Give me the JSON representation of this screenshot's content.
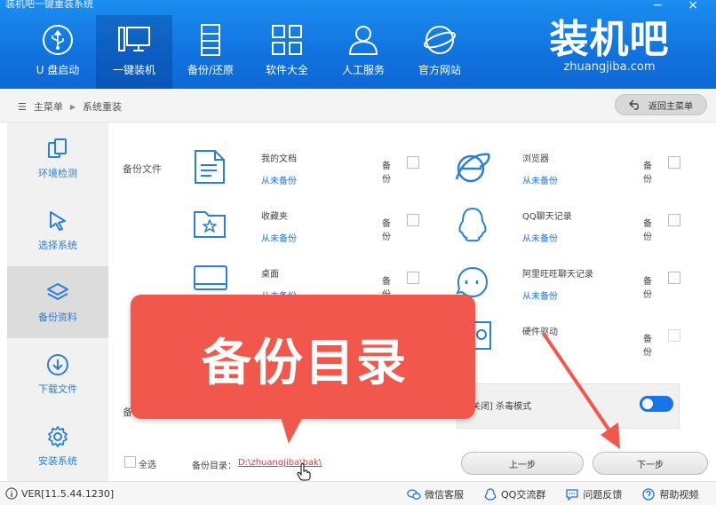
{
  "window": {
    "title": "装机吧一键重装系统",
    "min_glyph": "−",
    "close_glyph": "×"
  },
  "nav": {
    "items": [
      {
        "label": "U 盘启动",
        "icon": "usb-icon"
      },
      {
        "label": "一键装机",
        "icon": "monitor-icon"
      },
      {
        "label": "备份/还原",
        "icon": "server-icon"
      },
      {
        "label": "软件大全",
        "icon": "grid-icon"
      },
      {
        "label": "人工服务",
        "icon": "person-icon"
      },
      {
        "label": "官方网站",
        "icon": "globe-icon"
      }
    ],
    "active_index": 1
  },
  "logo": {
    "text": "装机吧",
    "domain": "zhuangjiba.com"
  },
  "breadcrumb": {
    "menu_glyph": "☰",
    "home": "主菜单",
    "sep": "▶",
    "current": "系统重装"
  },
  "back_button": {
    "label": "返回主菜单",
    "icon": "back-arrow-icon"
  },
  "sidebar": {
    "items": [
      {
        "label": "环境检测",
        "icon": "copy-icon"
      },
      {
        "label": "选择系统",
        "icon": "cursor-icon"
      },
      {
        "label": "备份资料",
        "icon": "layers-icon"
      },
      {
        "label": "下载文件",
        "icon": "download-icon"
      },
      {
        "label": "安装系统",
        "icon": "gear-icon"
      }
    ],
    "active_index": 2
  },
  "backup": {
    "section_label": "备份文件",
    "section_label_2": "备",
    "backup_label": "备份",
    "items": [
      {
        "name": "我的文档",
        "status": "从未备份",
        "icon": "document-icon"
      },
      {
        "name": "浏览器",
        "status": "从未备份",
        "icon": "browser-icon"
      },
      {
        "name": "收藏夹",
        "status": "从未备份",
        "icon": "folder-star-icon"
      },
      {
        "name": "QQ聊天记录",
        "status": "从未备份",
        "icon": "qq-icon"
      },
      {
        "name": "桌面",
        "status": "从未备份",
        "icon": "desktop-icon"
      },
      {
        "name": "阿里旺旺聊天记录",
        "status": "从未备份",
        "icon": "wangwang-icon"
      },
      {
        "name": "硬件驱动",
        "status": "",
        "icon": "hdd-icon"
      }
    ]
  },
  "antivirus": {
    "label": "已关闭] 杀毒模式",
    "enabled": false
  },
  "footer_actions": {
    "select_all": "全选",
    "dir_label": "备份目录：",
    "dir_path": "D:\\zhuangjiba\\bak\\",
    "prev": "上一步",
    "next": "下一步"
  },
  "callout": {
    "text": "备份目录"
  },
  "status_bar": {
    "version": "VER[11.5.44.1230]",
    "links": [
      {
        "label": "微信客服",
        "icon": "wechat-icon"
      },
      {
        "label": "QQ交流群",
        "icon": "qq-small-icon"
      },
      {
        "label": "问题反馈",
        "icon": "chat-icon"
      },
      {
        "label": "帮助视频",
        "icon": "help-icon"
      }
    ]
  },
  "colors": {
    "header": "#1173df",
    "accent": "#1a73e8",
    "callout": "#f2574b",
    "link_red": "#e33"
  }
}
